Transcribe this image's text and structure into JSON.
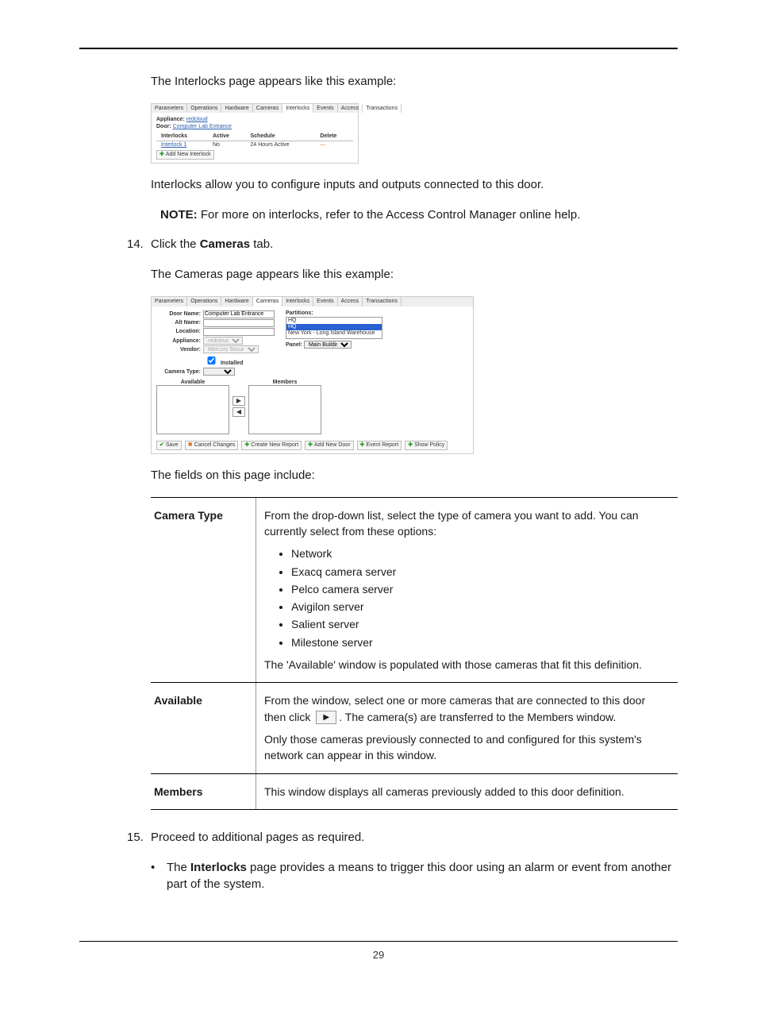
{
  "page_number": "29",
  "intro": {
    "interlocks_caption": "The Interlocks page appears like this example:",
    "interlocks_para": "Interlocks allow you to configure inputs and outputs connected to this door.",
    "note_label": "NOTE:",
    "note_text": " For more on interlocks, refer to the Access Control Manager online help."
  },
  "step14": {
    "num": "14.",
    "line_pre": "Click the ",
    "line_bold": "Cameras",
    "line_post": " tab.",
    "caption": "The Cameras page appears like this example:",
    "fields_caption": "The fields on this page include:"
  },
  "step15": {
    "num": "15.",
    "line": "Proceed to additional pages as required.",
    "bullet_pre": "The ",
    "bullet_bold": "Interlocks",
    "bullet_post": " page provides a means to trigger this door using an alarm or event from another part of the system."
  },
  "field_table": {
    "camera_type": {
      "label": "Camera Type",
      "intro": "From the drop-down list, select the type of camera you want to add. You can currently select from these options:",
      "options": [
        "Network",
        "Exacq camera server",
        "Pelco camera server",
        "Avigilon server",
        "Salient server",
        "Milestone server"
      ],
      "outro": "The 'Available' window is populated with those cameras that fit this definition."
    },
    "available": {
      "label": "Available",
      "p1_pre": "From the window, select one or more cameras that are connected to this door then click ",
      "p1_post": ". The camera(s) are transferred to the Members window.",
      "p2": "Only those cameras previously connected to and configured for this system's network can appear in this window."
    },
    "members": {
      "label": "Members",
      "text": "This window displays all cameras previously added to this door definition."
    }
  },
  "shot_interlocks": {
    "tabs": [
      "Parameters",
      "Operations",
      "Hardware",
      "Cameras",
      "Interlocks",
      "Events",
      "Access",
      "Transactions"
    ],
    "active_tab": 4,
    "appliance_label": "Appliance:",
    "appliance_value": "redcloud",
    "door_label": "Door:",
    "door_value": "Computer Lab Entrance",
    "cols": [
      "Interlocks",
      "Active",
      "Schedule",
      "Delete"
    ],
    "row": {
      "name": "Interlock 1",
      "active": "No",
      "schedule": "24 Hours Active",
      "delete": "—"
    },
    "add_btn": "Add New Interlock"
  },
  "shot_cameras": {
    "tabs": [
      "Parameters",
      "Operations",
      "Hardware",
      "Cameras",
      "Interlocks",
      "Events",
      "Access",
      "Transactions"
    ],
    "active_tab": 3,
    "fields": {
      "door_name_label": "Door Name:",
      "door_name_value": "Computer Lab Entrance",
      "alt_name_label": "Alt Name:",
      "alt_name_value": "",
      "location_label": "Location:",
      "location_value": "",
      "appliance_label": "Appliance:",
      "appliance_value": "redcloud",
      "vendor_label": "Vendor:",
      "vendor_value": "Mercury Security",
      "installed_label": "Installed",
      "camera_type_label": "Camera Type:",
      "partitions_label": "Partitions:",
      "partitions": [
        "HQ",
        "HQ",
        "New York - Long Island Warehouse"
      ],
      "panel_label": "Panel:",
      "panel_value": "Main Building",
      "available_label": "Available",
      "members_label": "Members"
    },
    "buttons": [
      "Save",
      "Cancel Changes",
      "Create New Report",
      "Add New Door",
      "Event Report",
      "Show Policy"
    ]
  }
}
